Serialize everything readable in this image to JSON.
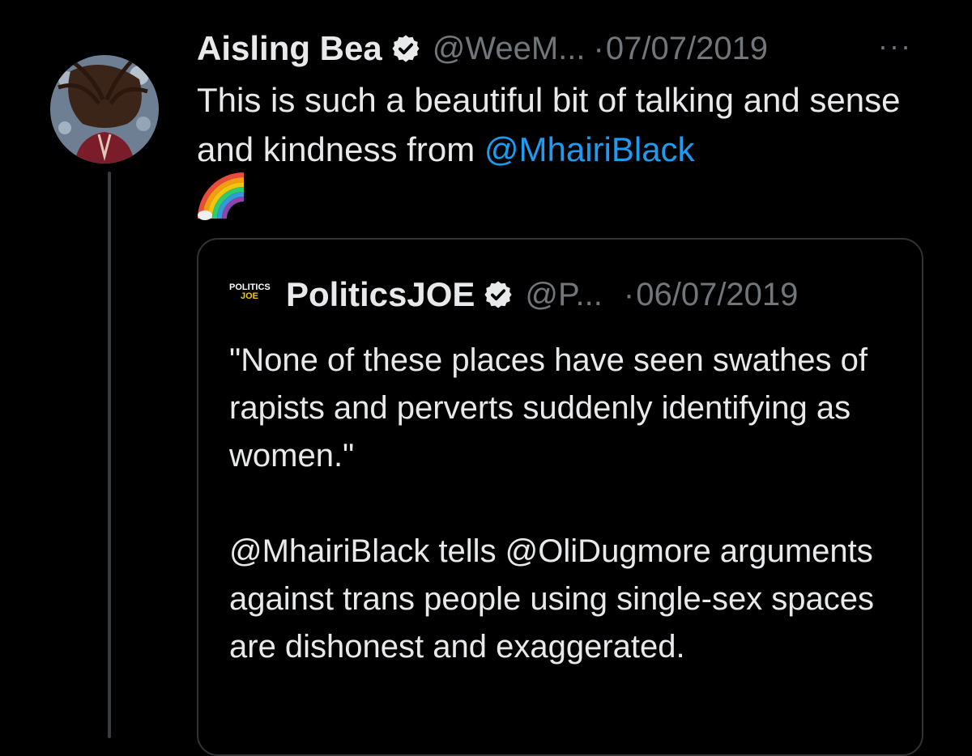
{
  "tweet": {
    "author_name": "Aisling Bea",
    "handle": "@WeeM...",
    "separator": "·",
    "date": "07/07/2019",
    "more_label": "···",
    "text_before": "This is such a beautiful bit of talking and sense and kindness from ",
    "mention": "@MhairiBlack",
    "emoji": "rainbow"
  },
  "quoted_tweet": {
    "logo_line1": "POLITICS",
    "logo_line2": "JOE",
    "author_name": "PoliticsJOE",
    "handle": "@P...",
    "separator": "·",
    "date": "06/07/2019",
    "paragraph1": "\"None of these places have seen swathes of rapists and perverts suddenly identifying as women.\"",
    "paragraph2": "@MhairiBlack tells @OliDugmore arguments against trans people using single-sex spaces are dishonest and exaggerated."
  },
  "colors": {
    "background": "#000000",
    "text": "#e7e9ea",
    "muted": "#71767b",
    "link": "#1d9bf0",
    "border": "#2f3336"
  }
}
